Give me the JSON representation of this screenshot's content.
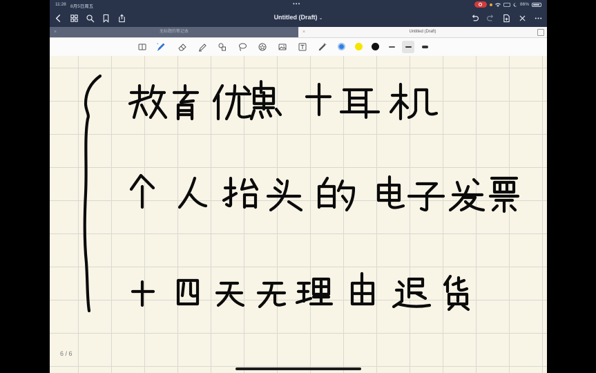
{
  "status_bar": {
    "time": "11:28",
    "date": "8月5日周五",
    "battery": "86%"
  },
  "nav": {
    "title": "Untitled (Draft)",
    "title_chevron": "⌄"
  },
  "tabs": [
    {
      "label": "无标题的笔记本",
      "active": false
    },
    {
      "label": "Untitled (Draft)",
      "active": true
    }
  ],
  "toolbar": {
    "tools": [
      "page-nav-icon",
      "pen-icon",
      "eraser-icon",
      "highlighter-icon",
      "shapes-icon",
      "lasso-icon",
      "sticker-icon",
      "image-icon",
      "text-icon",
      "laser-pointer-icon"
    ],
    "selected_tool": "pen-icon",
    "colors": [
      "#2f7fe3",
      "#f5e600",
      "#111111"
    ],
    "selected_color": "#2f7fe3",
    "stroke_widths": [
      "thin",
      "medium",
      "thick"
    ],
    "selected_stroke": "medium"
  },
  "page": {
    "page_number": "6 / 6"
  },
  "handwriting": {
    "lines": [
      "教育优惠十耳机",
      "个人抬头的电子发票",
      "十四天无理由退货"
    ],
    "ink_color": "#0b0b0b"
  }
}
